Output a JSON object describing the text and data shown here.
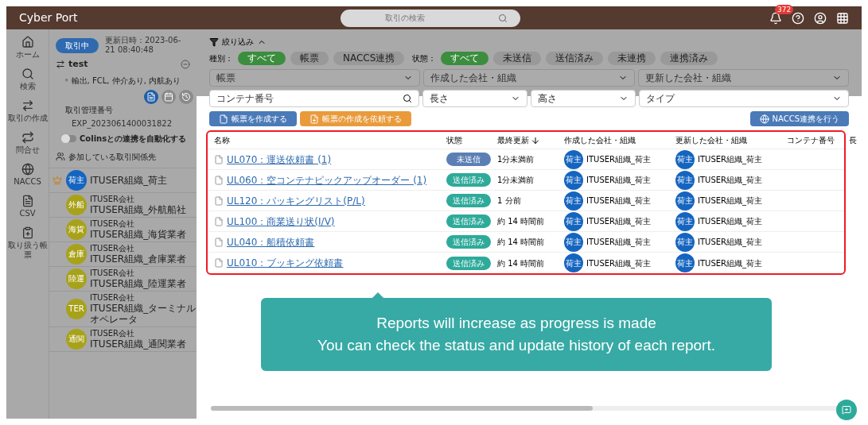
{
  "header": {
    "logo": "Cyber Port",
    "search": {
      "placeholder": "取引の検索"
    },
    "notification_count": "372"
  },
  "nav": [
    {
      "label": "ホーム"
    },
    {
      "label": "検索"
    },
    {
      "label": "取引の作成"
    },
    {
      "label": "問合せ"
    },
    {
      "label": "NACCS"
    },
    {
      "label": "CSV"
    },
    {
      "label": "取り扱う帳票"
    }
  ],
  "deal": {
    "status": "取引中",
    "updated": "更新日時：2023-06-21 08:40:48",
    "name": "test",
    "tags": "輸出, FCL, 仲介あり, 内航あり",
    "number_label": "取引管理番号",
    "number": "EXP_2023061400031822",
    "auto_link": {
      "label": "Colinsとの連携を自動化する",
      "on": false
    },
    "participants_title": "参加している取引関係先",
    "participants": [
      {
        "avatar": "荷主",
        "org": "ITUSER組織_荷主",
        "color": "#1565c0",
        "owner": true
      },
      {
        "avatar": "外船",
        "company": "ITUSER会社",
        "org": "ITUSER組織_外航船社",
        "color": "#a8a21a",
        "owner": false
      },
      {
        "avatar": "海貨",
        "company": "ITUSER会社",
        "org": "ITUSER組織_海貨業者",
        "color": "#a8a21a",
        "owner": false
      },
      {
        "avatar": "倉庫",
        "company": "ITUSER会社",
        "org": "ITUSER組織_倉庫業者",
        "color": "#a8a21a",
        "owner": false
      },
      {
        "avatar": "陸運",
        "company": "ITUSER会社",
        "org": "ITUSER組織_陸運業者",
        "color": "#a8a21a",
        "owner": false
      },
      {
        "avatar": "TER",
        "company": "ITUSER会社",
        "org": "ITUSER組織_ターミナルオペレータ",
        "color": "#a8a21a",
        "owner": false
      },
      {
        "avatar": "通関",
        "company": "ITUSER会社",
        "org": "ITUSER組織_通関業者",
        "color": "#a8a21a",
        "owner": false
      }
    ]
  },
  "filter": {
    "title": "絞り込み",
    "type_label": "種別：",
    "types": [
      {
        "label": "すべて",
        "selected": true
      },
      {
        "label": "帳票",
        "selected": false
      },
      {
        "label": "NACCS連携",
        "selected": false
      }
    ],
    "state_label": "状態：",
    "states": [
      {
        "label": "すべて",
        "selected": true
      },
      {
        "label": "未送信",
        "selected": false
      },
      {
        "label": "送信済み",
        "selected": false
      },
      {
        "label": "未連携",
        "selected": false
      },
      {
        "label": "連携済み",
        "selected": false
      }
    ],
    "row1": [
      {
        "kind": "select",
        "placeholder": "帳票"
      },
      {
        "kind": "select",
        "placeholder": "作成した会社・組織"
      },
      {
        "kind": "select",
        "placeholder": "更新した会社・組織"
      }
    ],
    "row2": [
      {
        "kind": "search",
        "placeholder": "コンテナ番号"
      },
      {
        "kind": "select",
        "placeholder": "長さ"
      },
      {
        "kind": "select",
        "placeholder": "高さ"
      },
      {
        "kind": "select",
        "placeholder": "タイプ"
      }
    ]
  },
  "actions": {
    "create": "帳票を作成する",
    "request": "帳票の作成を依頼する",
    "naccs": "NACCS連携を行う"
  },
  "table": {
    "columns": [
      "名称",
      "状態",
      "最終更新",
      "作成した会社・組織",
      "更新した会社・組織",
      "コンテナ番号",
      "長"
    ],
    "rows": [
      {
        "name": "UL070：運送依頼書 (1)",
        "status": "未送信",
        "kind": "unsent",
        "updated": "1分未満前",
        "creator_avatar": "荷主",
        "creator": "ITUSER組織_荷主",
        "updater_avatar": "荷主",
        "updater": "ITUSER組織_荷主"
      },
      {
        "name": "UL060：空コンテナピックアップオーダー (1)",
        "status": "送信済み",
        "kind": "sent",
        "updated": "1分未満前",
        "creator_avatar": "荷主",
        "creator": "ITUSER組織_荷主",
        "updater_avatar": "荷主",
        "updater": "ITUSER組織_荷主"
      },
      {
        "name": "UL120：パッキングリスト(P/L)",
        "status": "送信済み",
        "kind": "sent",
        "updated": "1 分前",
        "creator_avatar": "荷主",
        "creator": "ITUSER組織_荷主",
        "updater_avatar": "荷主",
        "updater": "ITUSER組織_荷主"
      },
      {
        "name": "UL100：商業送り状(I/V)",
        "status": "送信済み",
        "kind": "sent",
        "updated": "約 14 時間前",
        "creator_avatar": "荷主",
        "creator": "ITUSER組織_荷主",
        "updater_avatar": "荷主",
        "updater": "ITUSER組織_荷主"
      },
      {
        "name": "UL040：船積依頼書",
        "status": "送信済み",
        "kind": "sent",
        "updated": "約 14 時間前",
        "creator_avatar": "荷主",
        "creator": "ITUSER組織_荷主",
        "updater_avatar": "荷主",
        "updater": "ITUSER組織_荷主"
      },
      {
        "name": "UL010：ブッキング依頼書",
        "status": "送信済み",
        "kind": "sent",
        "updated": "約 14 時間前",
        "creator_avatar": "荷主",
        "creator": "ITUSER組織_荷主",
        "updater_avatar": "荷主",
        "updater": "ITUSER組織_荷主"
      }
    ]
  },
  "callout": [
    "Reports will increase as progress is made",
    "You can check the status and update history of each report."
  ]
}
